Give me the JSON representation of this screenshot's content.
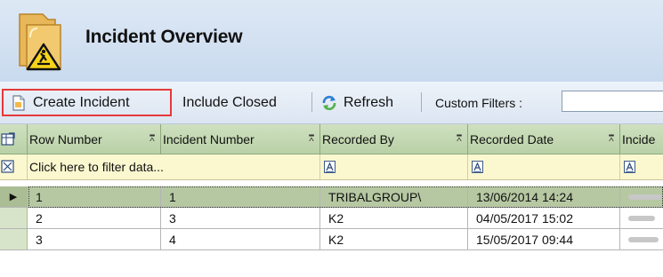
{
  "window": {
    "title": "Incident Overview"
  },
  "toolbar": {
    "create_label": "Create Incident",
    "include_closed_label": "Include Closed",
    "refresh_label": "Refresh",
    "custom_filters_label": "Custom Filters :",
    "custom_filters_value": ""
  },
  "grid": {
    "columns": [
      "Row Number",
      "Incident Number",
      "Recorded By",
      "Recorded Date",
      "Incide"
    ],
    "filter_placeholder": "Click here to filter data...",
    "rows": [
      {
        "row_number": "1",
        "incident_number": "1",
        "recorded_by": "TRIBALGROUP\\",
        "recorded_date": "13/06/2014 14:24",
        "selected": true
      },
      {
        "row_number": "2",
        "incident_number": "3",
        "recorded_by": "K2",
        "recorded_date": "04/05/2017 15:02",
        "selected": false
      },
      {
        "row_number": "3",
        "incident_number": "4",
        "recorded_by": "K2",
        "recorded_date": "15/05/2017 09:44",
        "selected": false
      }
    ]
  },
  "icons": {
    "title_icon": "warning-folder-icon",
    "create": "document-icon",
    "refresh": "refresh-icon",
    "column_pin": "pin-icon",
    "column_chooser": "column-chooser-icon",
    "filter_clear": "filter-clear-icon",
    "filter_operator": "filter-operator-icon",
    "row_indicator": "current-row-arrow-icon"
  },
  "colors": {
    "highlight_border": "#e43a3a",
    "header_green": "#b9d1a6",
    "selected_row": "#b6c8a2",
    "filter_row": "#fbf8d0"
  }
}
